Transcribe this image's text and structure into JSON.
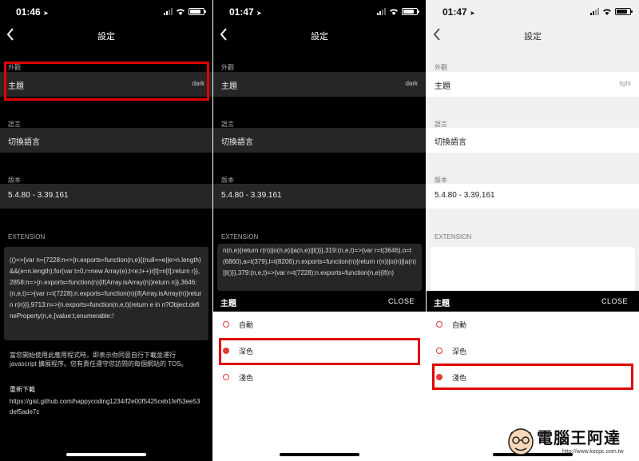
{
  "screens": [
    {
      "time": "01:46",
      "nav_title": "設定",
      "appearance_label": "外觀",
      "theme_label": "主題",
      "theme_value": "dark",
      "language_label": "語言",
      "switch_language": "切換語言",
      "version_label": "版本",
      "version_value": "5.4.80 - 3.39.161",
      "extension_label": "EXTENSION",
      "extension_code": "(()=>{var n={7228:n=>{n.exports=function(n,e){(null==e||e>n.length)&&(e=n.length);for(var t=0,r=new Array(e);t<e;t++)r[t]=n[t];return r}},2858:n=>{n.exports=function(n){if(Array.isArray(n))return n}},3646:(n,e,t)=>{var r=t(7228);n.exports=function(n){if(Array.isArray(n))return r(n)}},9713:n=>{n.exports=function(n,e,t){return e in n?Object.defineProperty(n,e,{value:t,enumerable:!",
      "notice": "當您開始使用此應用程式時，即表示你同意自行下載並運行 javascript 擴展程序。您有責任遵守您訪問的每個網站的 TOS。",
      "download_title": "重新下載",
      "download_url": "https://gist.github.com/happycoding1234/f2e00f5425ceb1fef53ee53def5ade7c"
    },
    {
      "time": "01:47",
      "nav_title": "設定",
      "appearance_label": "外觀",
      "theme_label": "主題",
      "theme_value": "dark",
      "language_label": "語言",
      "switch_language": "切換語言",
      "version_label": "版本",
      "version_value": "5.4.80 - 3.39.161",
      "extension_label": "EXTENSION",
      "extension_code": "n(n,e){return r(n)||o(n,e)||a(n,e)||l()}},319:(n,e,t)=>{var r=t(3646),o=t(6860),a=t(379),l=t(8206);n.exports=function(n){return r(n)||o(n)||a(n)||l()}},379:(n,e,t)=>{var r=t(7228);n.exports=function(n,e){if(n)",
      "sheet_title": "主題",
      "sheet_close": "CLOSE",
      "options": [
        "自動",
        "深色",
        "淺色"
      ],
      "selected_index": 1
    },
    {
      "time": "01:47",
      "nav_title": "設定",
      "appearance_label": "外觀",
      "theme_label": "主題",
      "theme_value": "light",
      "language_label": "語言",
      "switch_language": "切換語言",
      "version_label": "版本",
      "version_value": "5.4.80 - 3.39.161",
      "extension_label": "EXTENSION",
      "sheet_title": "主題",
      "sheet_close": "CLOSE",
      "options": [
        "自動",
        "深色",
        "淺色"
      ],
      "selected_index": 2
    }
  ],
  "watermark": {
    "title": "電腦王阿達",
    "url": "http://www.kocpc.com.tw"
  },
  "colors": {
    "highlight": "#e00000",
    "radio_accent": "#e53935",
    "dark_row": "#262626",
    "light_bg": "#f0f0f0"
  }
}
